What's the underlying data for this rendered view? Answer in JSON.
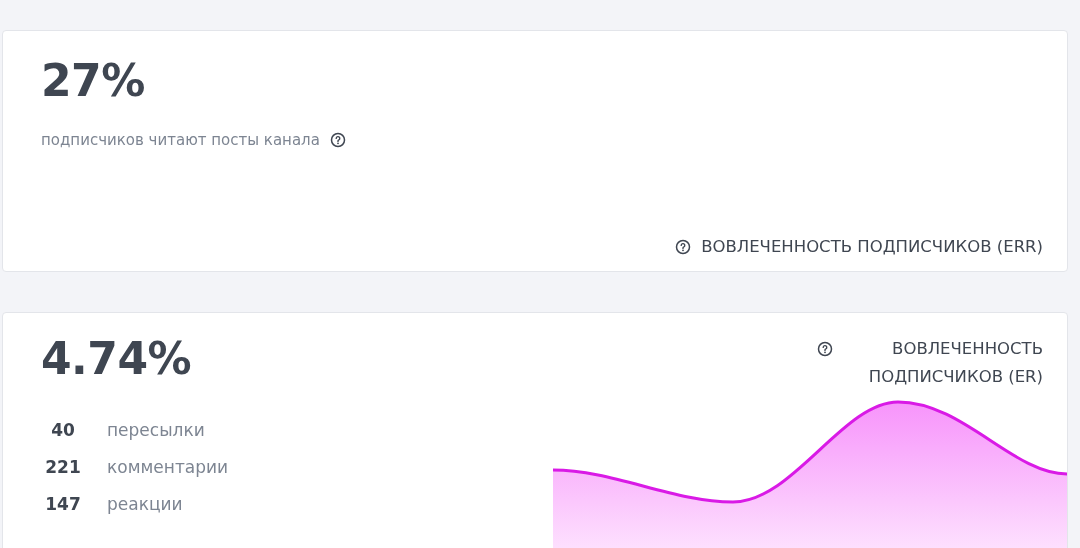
{
  "cards": [
    {
      "kind": "reach",
      "value": "27%",
      "caption": "подписчиков читают посты канала",
      "label": "ВОВЛЕЧЕННОСТЬ ПОДПИСЧИКОВ (ERR)"
    },
    {
      "kind": "engagement",
      "value": "4.74%",
      "label": "ВОВЛЕЧЕННОСТЬ ПОДПИСЧИКОВ (ER)",
      "stats": [
        {
          "count": "40",
          "label": "пересылки"
        },
        {
          "count": "221",
          "label": "комментарии"
        },
        {
          "count": "147",
          "label": "реакции"
        }
      ]
    }
  ]
}
